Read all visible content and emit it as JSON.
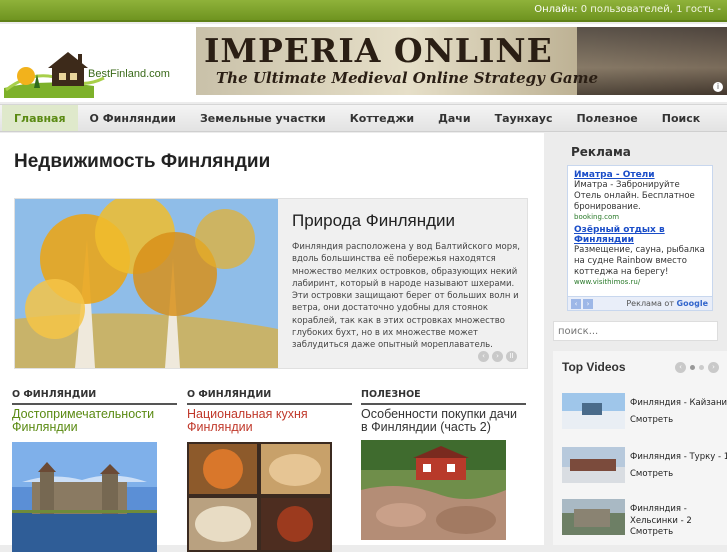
{
  "topbar": {
    "online_label": "Онлайн:",
    "online_value": "0 пользователей, 1 гость",
    "sep": "-"
  },
  "site": {
    "logo_text": "BestFinland.com"
  },
  "banner": {
    "title": "IMPERIA ONLINE",
    "subtitle": "The Ultimate Medieval Online Strategy Game",
    "info": "i"
  },
  "nav": {
    "items": [
      {
        "label": "Главная",
        "active": true
      },
      {
        "label": "О Финляндии"
      },
      {
        "label": "Земельные участки"
      },
      {
        "label": "Коттеджи"
      },
      {
        "label": "Дачи"
      },
      {
        "label": "Таунхаус"
      },
      {
        "label": "Полезное"
      },
      {
        "label": "Поиск"
      }
    ]
  },
  "main": {
    "title": "Недвижимость Финляндии",
    "feature": {
      "title": "Природа Финляндии",
      "text": "Финляндия расположена у вод Балтийского моря, вдоль большинства её побережья находятся множество мелких островков, образующих некий лабиринт, который в народе называют шхерами. Эти островки защищают берег от больших волн и ветра, они достаточно удобны для стоянок кораблей, так как в этих островках множество глубоких бухт, но в их множестве может заблудиться даже опытный мореплаватель.",
      "prev": "‹",
      "next": "›",
      "pause": "II"
    },
    "columns": [
      {
        "category": "О ФИНЛЯНДИИ",
        "title": "Достопримечательности Финляндии"
      },
      {
        "category": "О ФИНЛЯНДИИ",
        "title": "Национальная кухня Финляндии"
      },
      {
        "category": "ПОЛЕЗНОЕ",
        "title": "Особенности покупки дачи в Финляндии (часть 2)"
      }
    ]
  },
  "sidebar": {
    "ads_title": "Реклама",
    "ads": [
      {
        "headline": "Иматра - Отели",
        "text": "Иматра - Забронируйте Отель онлайн. Бесплатное бронирование.",
        "url": "booking.com"
      },
      {
        "headline": "Озёрный отдых в Финляндии",
        "text": "Размещение, сауна, рыбалка на судне Rainbow вместо коттеджа на берегу!",
        "url": "www.visithimos.ru/"
      }
    ],
    "ads_by_prefix": "Реклама от",
    "ads_by_brand": "Google",
    "ads_prev": "‹",
    "ads_next": "›",
    "search_placeholder": "поиск...",
    "videos_title": "Top Videos",
    "videos_prev": "‹",
    "videos_next": "›",
    "videos": [
      {
        "title": "Финляндия - Кайзани",
        "action": "Смотреть"
      },
      {
        "title": "Финляндия - Турку - 1",
        "action": "Смотреть"
      },
      {
        "title": "Финляндия - Хельсинки - 2",
        "action": "Смотреть"
      }
    ]
  }
}
